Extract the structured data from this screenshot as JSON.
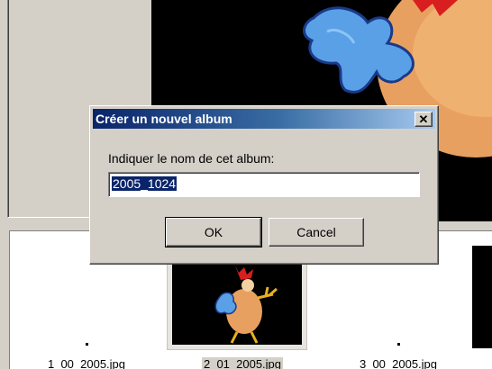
{
  "dialog": {
    "title": "Créer un nouvel album",
    "prompt": "Indiquer le nom de cet album:",
    "album_name_value": "2005_1024",
    "ok_label": "OK",
    "cancel_label": "Cancel",
    "close_glyph": "✕"
  },
  "thumbnails": [
    {
      "caption": "1_00_2005.jpg",
      "selected": false
    },
    {
      "caption": "2_01_2005.jpg",
      "selected": true
    },
    {
      "caption": "3_00_2005.jpg",
      "selected": false
    }
  ],
  "icons": {
    "close": "close-icon"
  },
  "colors": {
    "titlebar_start": "#0a246a",
    "titlebar_end": "#a6caf0",
    "selection": "#0a246a",
    "window_face": "#d4d0c8"
  }
}
